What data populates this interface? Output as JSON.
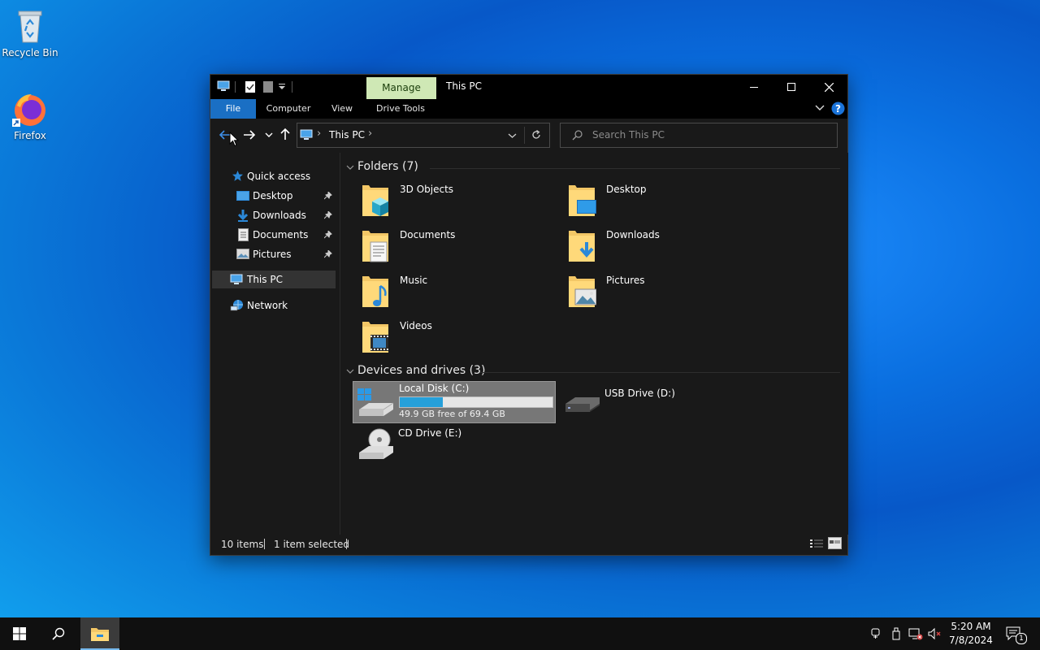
{
  "desktop": {
    "icons": [
      {
        "label": "Recycle Bin",
        "icon": "recycle-bin-icon"
      },
      {
        "label": "Firefox",
        "icon": "firefox-icon"
      }
    ]
  },
  "window": {
    "title": "This PC",
    "manage_tab": "Manage",
    "ribbon_tabs": [
      "File",
      "Computer",
      "View",
      "Drive Tools"
    ],
    "address": {
      "location": "This PC",
      "separator": "›"
    },
    "search": {
      "placeholder": "Search This PC"
    },
    "sidebar": {
      "quick_access": "Quick access",
      "pinned": [
        "Desktop",
        "Downloads",
        "Documents",
        "Pictures"
      ],
      "this_pc": "This PC",
      "network": "Network"
    },
    "folders_group": "Folders (7)",
    "folders": [
      "3D Objects",
      "Desktop",
      "Documents",
      "Downloads",
      "Music",
      "Pictures",
      "Videos"
    ],
    "devices_group": "Devices and drives (3)",
    "drives": [
      {
        "name": "Local Disk (C:)",
        "detail": "49.9 GB free of 69.4 GB",
        "used_fraction": 0.28
      },
      {
        "name": "USB Drive (D:)"
      },
      {
        "name": "CD Drive (E:)"
      }
    ],
    "status": {
      "items": "10 items",
      "selected": "1 item selected"
    }
  },
  "taskbar": {
    "time": "5:20 AM",
    "date": "7/8/2024",
    "notification_count": "1"
  },
  "colors": {
    "accent": "#0078d7",
    "drive_bar": "#26a0da",
    "manage_tab": "#cfe8b5"
  }
}
